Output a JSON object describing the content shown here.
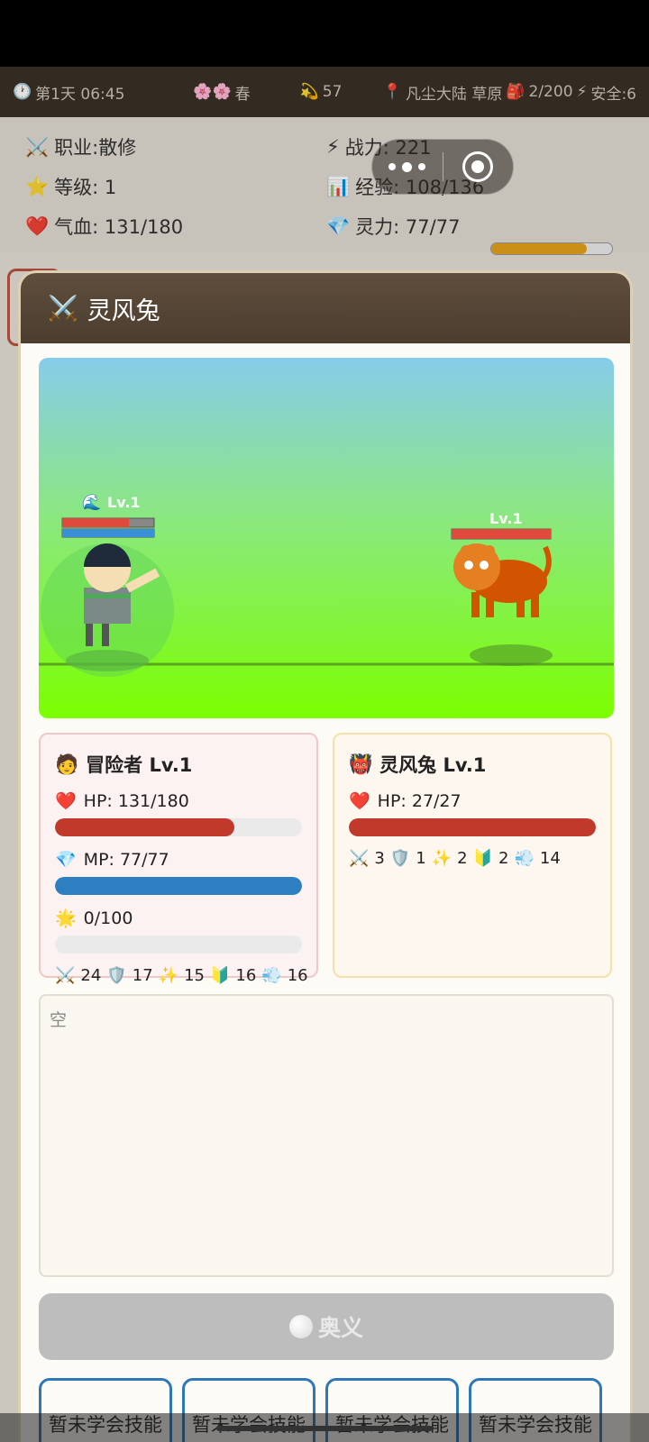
{
  "topbar": {
    "day": "第1天 06:45",
    "season": "春",
    "spirit": "57",
    "location": "凡尘大陆 草原",
    "bag": "2/200",
    "safety": "安全:6"
  },
  "stats": {
    "class": "职业:散修",
    "power": "战力: 221",
    "level": "等级: 1",
    "exp": "经验: 108/136",
    "exp_ratio": 0.794,
    "hp": "气血: 131/180",
    "hp_ratio": 0.728,
    "mp": "灵力: 77/77",
    "mp_ratio": 1.0
  },
  "battle": {
    "title": "灵风兔",
    "player_tag": "Lv.1",
    "enemy_tag": "Lv.1",
    "player_hp_ratio": 0.728,
    "player_mp_ratio": 1.0,
    "enemy_hp_ratio": 1.0
  },
  "player": {
    "name": "冒险者 Lv.1",
    "hp": "HP: 131/180",
    "hp_ratio": 0.728,
    "mp": "MP: 77/77",
    "mp_ratio": 1.0,
    "rage": "0/100",
    "rage_ratio": 0.0,
    "atk": "24",
    "def": "17",
    "mag": "15",
    "res": "16",
    "spd": "16"
  },
  "enemy": {
    "name": "灵风兔 Lv.1",
    "hp": "HP: 27/27",
    "hp_ratio": 1.0,
    "atk": "3",
    "def": "1",
    "mag": "2",
    "res": "2",
    "spd": "14"
  },
  "log": {
    "text": "空"
  },
  "ultimate": {
    "label": "奥义"
  },
  "skills": [
    {
      "label": "暂未学会技能"
    },
    {
      "label": "暂未学会技能"
    },
    {
      "label": "暂未学会技能"
    },
    {
      "label": "暂未学会技能"
    }
  ],
  "colors": {
    "hp": "#c0392b",
    "mp": "#2e7fc1",
    "exp": "#e8a21a",
    "header": "#4c3d2f",
    "skill_border": "#2e78b7"
  }
}
